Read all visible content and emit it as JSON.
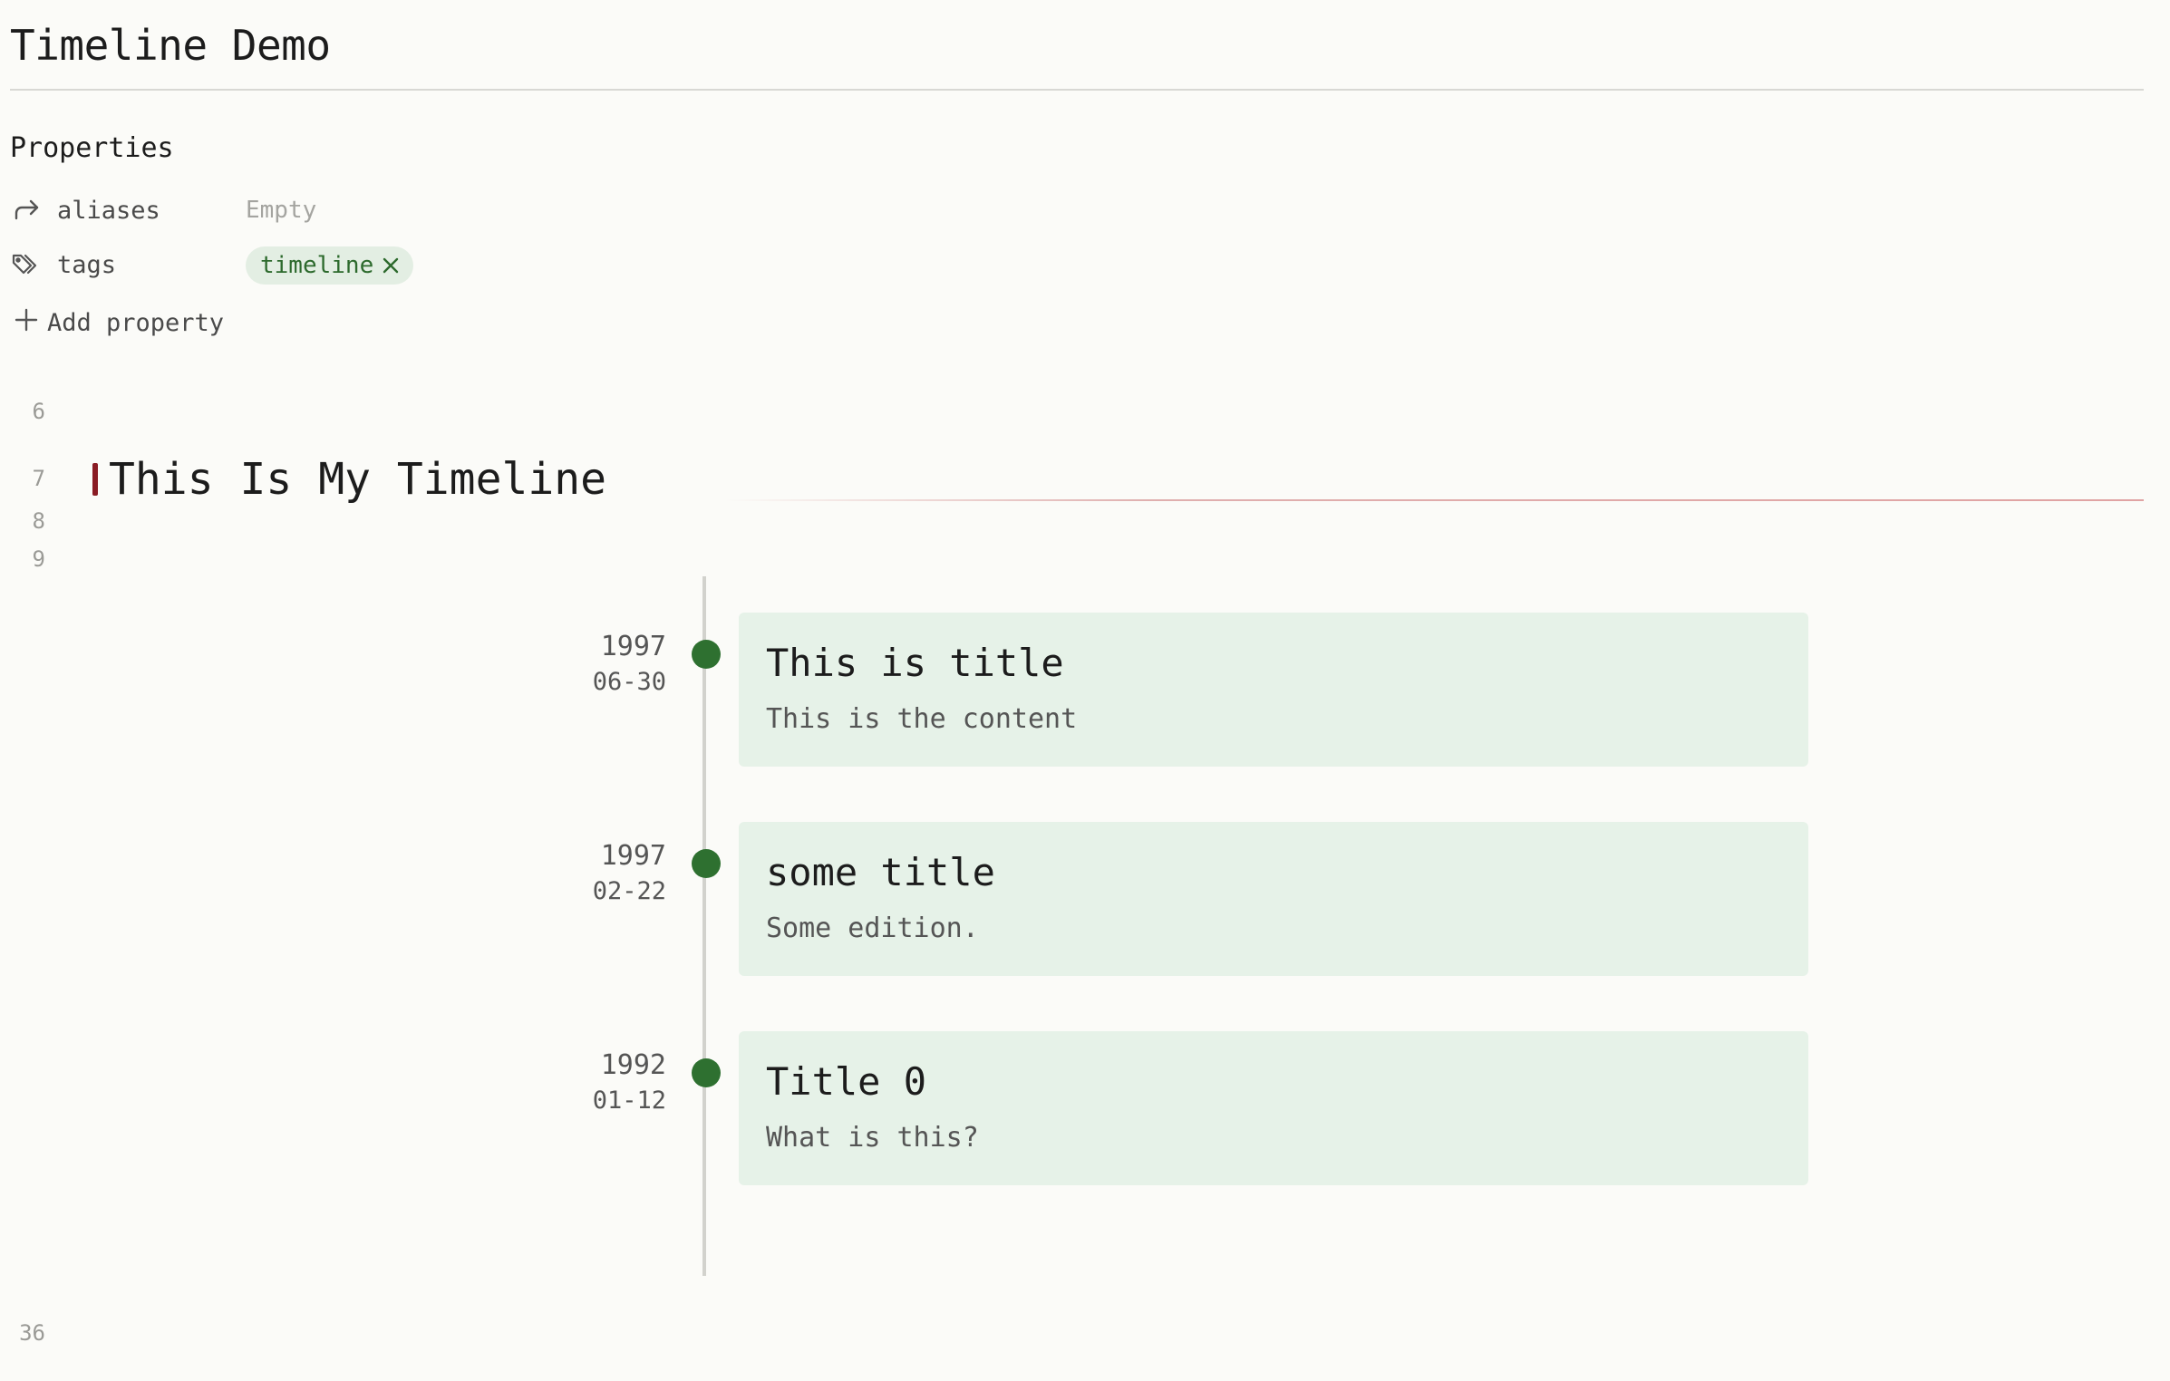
{
  "note": {
    "title": "Timeline Demo"
  },
  "properties": {
    "heading": "Properties",
    "aliases": {
      "key": "aliases",
      "icon": "arrow-forward-icon",
      "value": "Empty"
    },
    "tags": {
      "key": "tags",
      "icon": "tags-icon",
      "value": "timeline",
      "remove_icon": "close-icon",
      "pill_color": "#e3eee3",
      "pill_text_color": "#2d6a2d"
    },
    "add_label": "Add property",
    "add_icon": "plus-icon"
  },
  "editor": {
    "line_numbers": [
      "6",
      "7",
      "8",
      "9",
      "36"
    ],
    "heading": "This Is My Timeline",
    "heading_marker_color": "#8a1c24"
  },
  "timeline": {
    "accent_color": "#2e7030",
    "card_color": "#e6f2e8",
    "events": [
      {
        "year": "1997",
        "date": "06-30",
        "title": "This is title",
        "content": "This is the content"
      },
      {
        "year": "1997",
        "date": "02-22",
        "title": "some title",
        "content": "Some edition."
      },
      {
        "year": "1992",
        "date": "01-12",
        "title": "Title 0",
        "content": "What is this?"
      }
    ]
  }
}
